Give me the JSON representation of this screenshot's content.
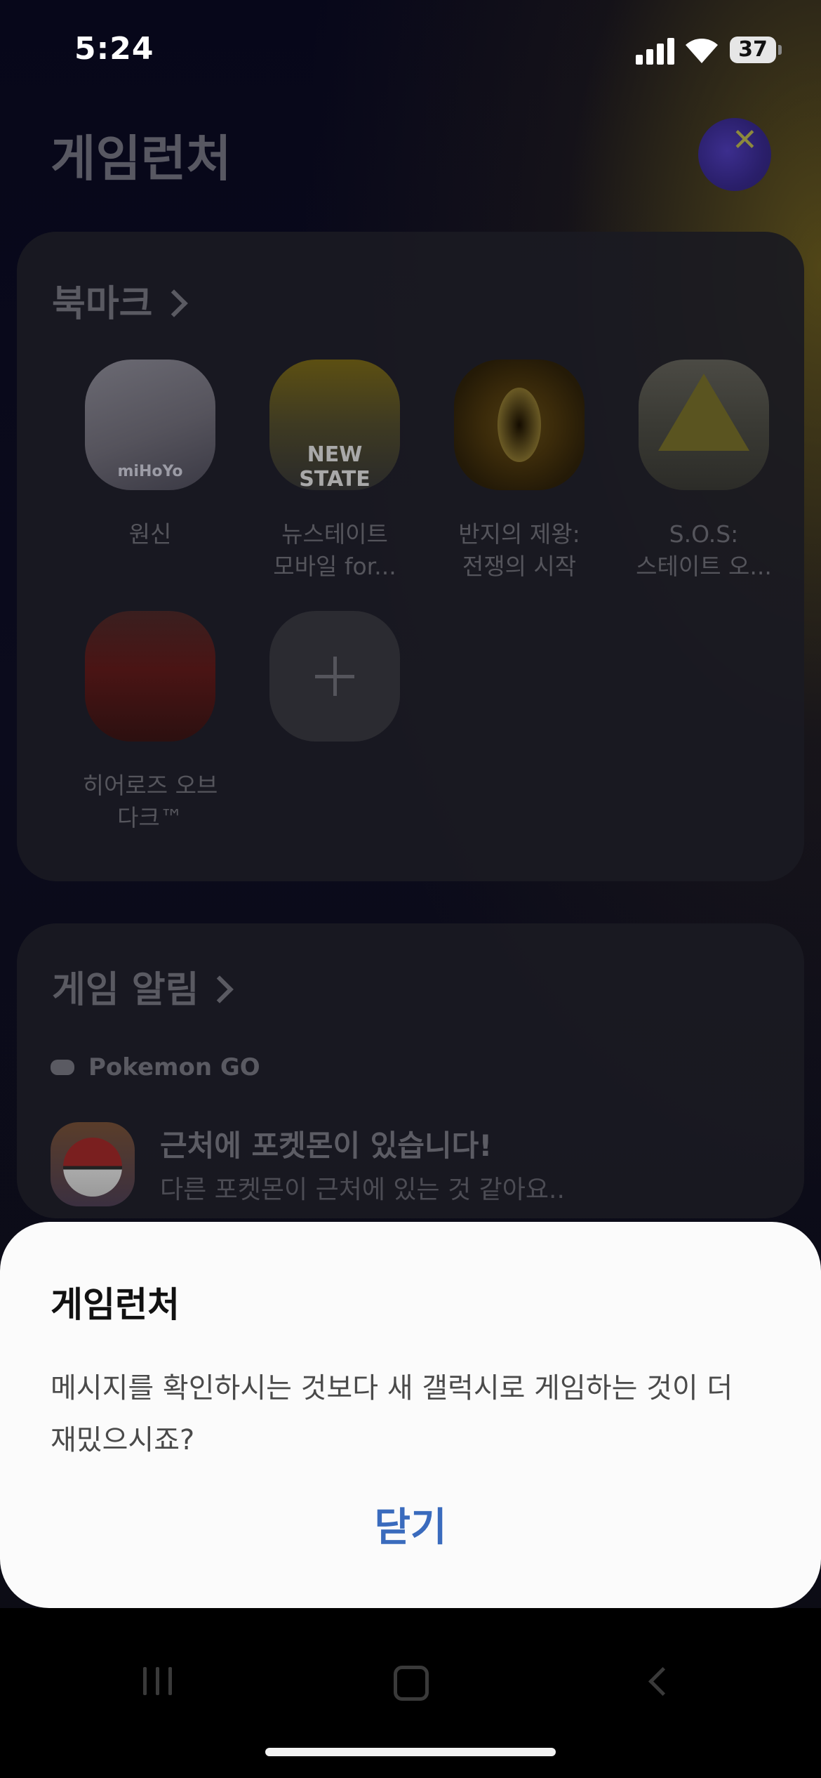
{
  "status_bar": {
    "time": "5:24",
    "battery": "37"
  },
  "header": {
    "title": "게임런처"
  },
  "bookmarks": {
    "header": "북마크",
    "apps": [
      {
        "label": "원신",
        "icon": "genshin-icon"
      },
      {
        "label": "뉴스테이트\n모바일 for...",
        "icon": "pubg-new-state-icon"
      },
      {
        "label": "반지의 제왕:\n전쟁의 시작",
        "icon": "lotr-ring-icon"
      },
      {
        "label": "S.O.S:\n스테이트 오...",
        "icon": "sos-state-survival-icon"
      },
      {
        "label": "히어로즈 오브\n다크™",
        "icon": "heroes-of-the-dark-icon"
      }
    ],
    "add_icon": "plus-icon"
  },
  "game_alerts": {
    "header": "게임 알림",
    "notification": {
      "app_name": "Pokemon GO",
      "title": "근처에 포켓몬이 있습니다!",
      "body": "다른 포켓몬이 근처에 있는 것 같아요.."
    }
  },
  "dialog": {
    "title": "게임런처",
    "message": "메시지를 확인하시는 것보다 새 갤럭시로 게임하는 것이 더 재밌으시죠?",
    "close_label": "닫기"
  },
  "colors": {
    "dialog_bg": "#fbfbfb",
    "accent": "#3a6bbd",
    "background": "#0b0b18"
  }
}
